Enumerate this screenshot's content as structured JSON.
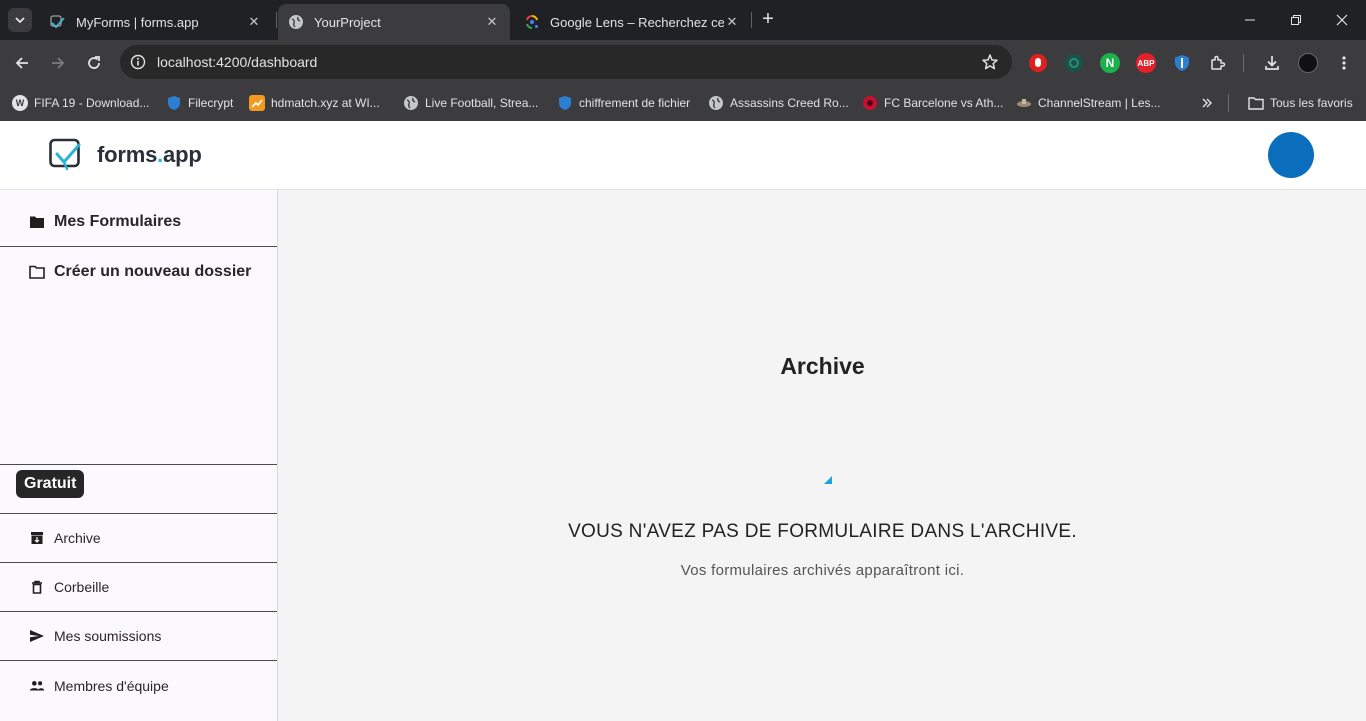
{
  "browser": {
    "tabs": [
      {
        "title": "MyForms | forms.app",
        "favicon": "forms-app-icon"
      },
      {
        "title": "YourProject",
        "favicon": "globe-icon"
      },
      {
        "title": "Google Lens – Recherchez ce qu",
        "favicon": "google-lens-icon"
      }
    ],
    "url": "localhost:4200/dashboard",
    "bookmarks": [
      {
        "label": "FIFA 19 - Download..."
      },
      {
        "label": "Filecrypt"
      },
      {
        "label": "hdmatch.xyz at WI..."
      },
      {
        "label": "Live Football, Strea..."
      },
      {
        "label": "chiffrement de fichier"
      },
      {
        "label": "Assassins Creed Ro..."
      },
      {
        "label": "FC Barcelone vs Ath..."
      },
      {
        "label": "ChannelStream | Les..."
      }
    ],
    "all_bookmarks_label": "Tous les favoris",
    "extensions": [
      {
        "name": "hand-stop-extension-icon",
        "color": "#e0201f"
      },
      {
        "name": "green-circle-extension-icon",
        "color": "#16534a"
      },
      {
        "name": "n-extension-icon",
        "color": "#19b24b",
        "text": "N"
      },
      {
        "name": "adblock-plus-extension-icon",
        "color": "#e4202b",
        "text": "ABP"
      },
      {
        "name": "shield-extension-icon",
        "color": "#2a7fd3"
      }
    ]
  },
  "app": {
    "logo_text_a": "forms",
    "logo_text_dot": ".",
    "logo_text_b": "app",
    "accent": "#25b5d8",
    "avatar_color": "#0a6ebd"
  },
  "sidebar": {
    "my_forms": "Mes Formulaires",
    "new_folder": "Créer un nouveau dossier",
    "plan_badge": "Gratuit",
    "archive": "Archive",
    "trash": "Corbeille",
    "submissions": "Mes soumissions",
    "team": "Membres d'équipe"
  },
  "main": {
    "title": "Archive",
    "empty_heading": "VOUS N'AVEZ PAS DE FORMULAIRE DANS L'ARCHIVE.",
    "empty_subtitle": "Vos formulaires archivés apparaîtront ici."
  }
}
